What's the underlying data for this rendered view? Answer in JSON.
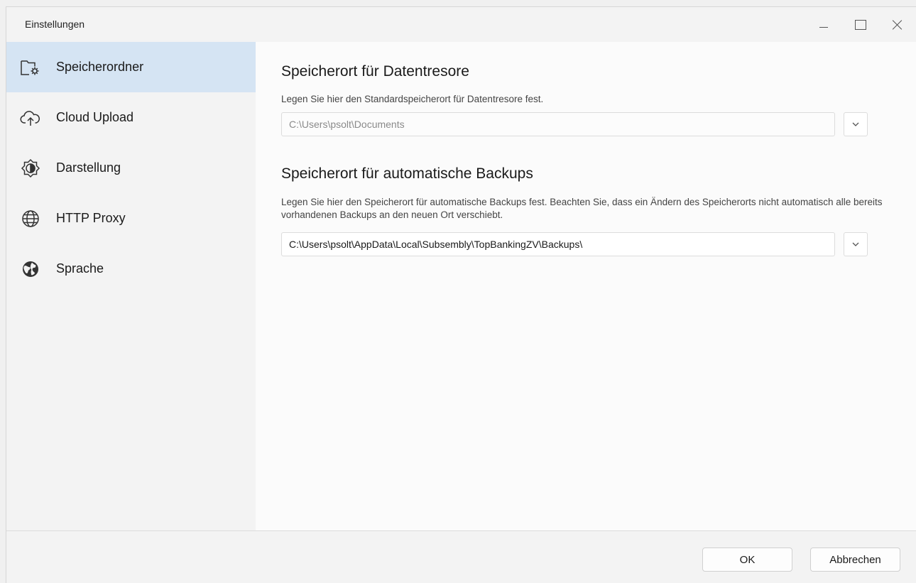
{
  "window": {
    "title": "Einstellungen"
  },
  "sidebar": {
    "items": [
      {
        "label": "Speicherordner",
        "icon": "folder-settings-icon",
        "active": true
      },
      {
        "label": "Cloud Upload",
        "icon": "cloud-upload-icon",
        "active": false
      },
      {
        "label": "Darstellung",
        "icon": "appearance-icon",
        "active": false
      },
      {
        "label": "HTTP Proxy",
        "icon": "globe-icon",
        "active": false
      },
      {
        "label": "Sprache",
        "icon": "language-globe-icon",
        "active": false
      }
    ]
  },
  "main": {
    "vault_section": {
      "title": "Speicherort für Datentresore",
      "description": "Legen Sie hier den Standardspeicherort für Datentresore fest.",
      "path": "C:\\Users\\psolt\\Documents"
    },
    "backup_section": {
      "title": "Speicherort für automatische Backups",
      "description": "Legen Sie hier den Speicherort für automatische Backups fest. Beachten Sie, dass ein Ändern des Speicherorts nicht automatisch alle bereits vorhandenen Backups an den neuen Ort verschiebt.",
      "path": "C:\\Users\\psolt\\AppData\\Local\\Subsembly\\TopBankingZV\\Backups\\"
    }
  },
  "footer": {
    "ok_label": "OK",
    "cancel_label": "Abbrechen"
  },
  "colors": {
    "active_nav_bg": "#d5e4f3",
    "content_bg": "#fbfbfb",
    "sidebar_bg": "#f3f3f3"
  }
}
